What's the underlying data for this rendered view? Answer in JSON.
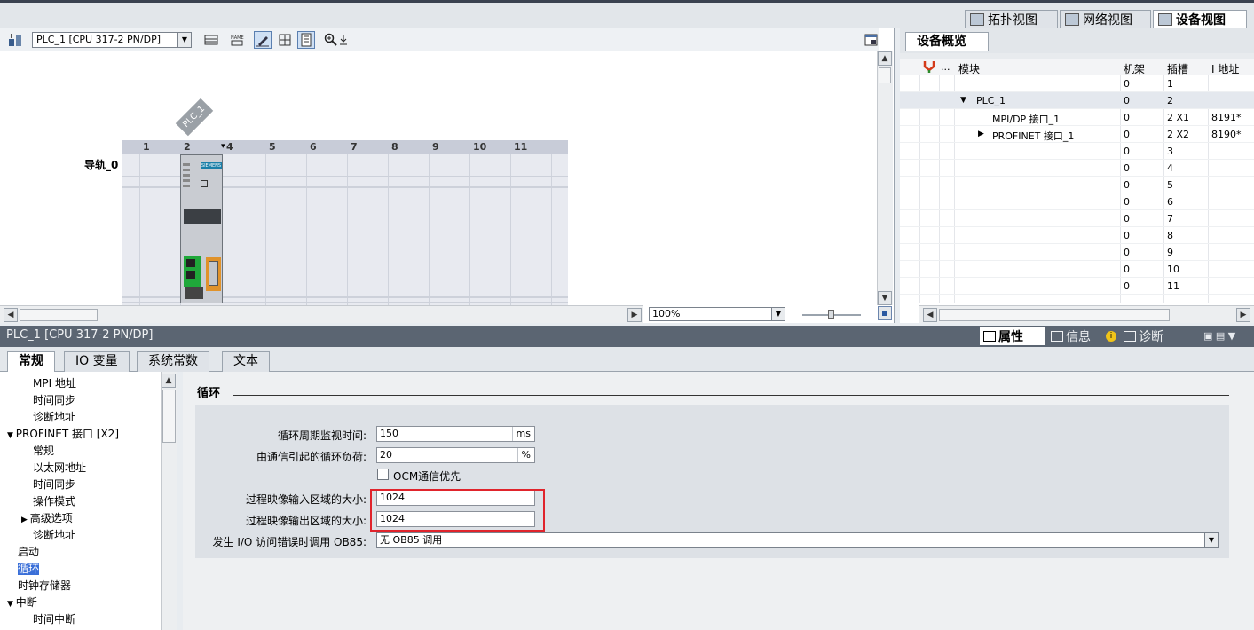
{
  "view_tabs": [
    {
      "label": "拓扑视图",
      "active": false
    },
    {
      "label": "网络视图",
      "active": false
    },
    {
      "label": "设备视图",
      "active": true
    }
  ],
  "canvas": {
    "device_select": "PLC_1 [CPU 317-2 PN/DP]",
    "plc_tag": "PLC_1",
    "rail_label": "导轨_0",
    "slots": [
      "1",
      "2",
      "4",
      "5",
      "6",
      "7",
      "8",
      "9",
      "10",
      "11"
    ],
    "cpu_brand": "SIEMENS",
    "zoom": "100%"
  },
  "overview": {
    "tab_label": "设备概览",
    "columns": [
      "...",
      "模块",
      "机架",
      "插槽",
      "I 地址"
    ],
    "rows": [
      {
        "module": "",
        "rack": "0",
        "slot": "1",
        "addr": ""
      },
      {
        "module": "PLC_1",
        "rack": "0",
        "slot": "2",
        "addr": ""
      },
      {
        "module": "MPI/DP 接口_1",
        "rack": "0",
        "slot": "2 X1",
        "addr": "8191*"
      },
      {
        "module": "PROFINET 接口_1",
        "rack": "0",
        "slot": "2 X2",
        "addr": "8190*"
      },
      {
        "module": "",
        "rack": "0",
        "slot": "3",
        "addr": ""
      },
      {
        "module": "",
        "rack": "0",
        "slot": "4",
        "addr": ""
      },
      {
        "module": "",
        "rack": "0",
        "slot": "5",
        "addr": ""
      },
      {
        "module": "",
        "rack": "0",
        "slot": "6",
        "addr": ""
      },
      {
        "module": "",
        "rack": "0",
        "slot": "7",
        "addr": ""
      },
      {
        "module": "",
        "rack": "0",
        "slot": "8",
        "addr": ""
      },
      {
        "module": "",
        "rack": "0",
        "slot": "9",
        "addr": ""
      },
      {
        "module": "",
        "rack": "0",
        "slot": "10",
        "addr": ""
      },
      {
        "module": "",
        "rack": "0",
        "slot": "11",
        "addr": ""
      }
    ]
  },
  "props": {
    "title": "PLC_1 [CPU 317-2 PN/DP]",
    "tabs": [
      "属性",
      "信息",
      "诊断"
    ],
    "sub_tabs": [
      "常规",
      "IO 变量",
      "系统常数",
      "文本"
    ]
  },
  "nav": [
    "MPI 地址",
    "时间同步",
    "诊断地址",
    "PROFINET 接口 [X2]",
    "常规",
    "以太网地址",
    "时间同步",
    "操作模式",
    "高级选项",
    "诊断地址",
    "启动",
    "循环",
    "时钟存储器",
    "中断",
    "时间中断"
  ],
  "cycle": {
    "section_title": "循环",
    "max_cycle_label": "循环周期监视时间:",
    "max_cycle_value": "150",
    "max_cycle_unit": "ms",
    "comm_load_label": "由通信引起的循环负荷:",
    "comm_load_value": "20",
    "comm_load_unit": "%",
    "ocm_label": "OCM通信优先",
    "pi_input_label": "过程映像输入区域的大小:",
    "pi_input_value": "1024",
    "pi_output_label": "过程映像输出区域的大小:",
    "pi_output_value": "1024",
    "ob85_label": "发生 I/O 访问错误时调用 OB85:",
    "ob85_value": "无 OB85 调用"
  }
}
